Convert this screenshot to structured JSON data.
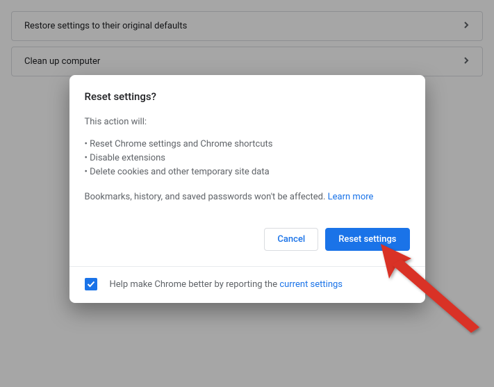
{
  "settings": {
    "rows": [
      {
        "label": "Restore settings to their original defaults"
      },
      {
        "label": "Clean up computer"
      }
    ]
  },
  "dialog": {
    "title": "Reset settings?",
    "intro": "This action will:",
    "bullets": [
      "Reset Chrome settings and Chrome shortcuts",
      "Disable extensions",
      "Delete cookies and other temporary site data"
    ],
    "note": "Bookmarks, history, and saved passwords won't be affected. ",
    "learn_more": "Learn more",
    "cancel_label": "Cancel",
    "confirm_label": "Reset settings",
    "footer_text": "Help make Chrome better by reporting the ",
    "footer_link": "current settings"
  }
}
